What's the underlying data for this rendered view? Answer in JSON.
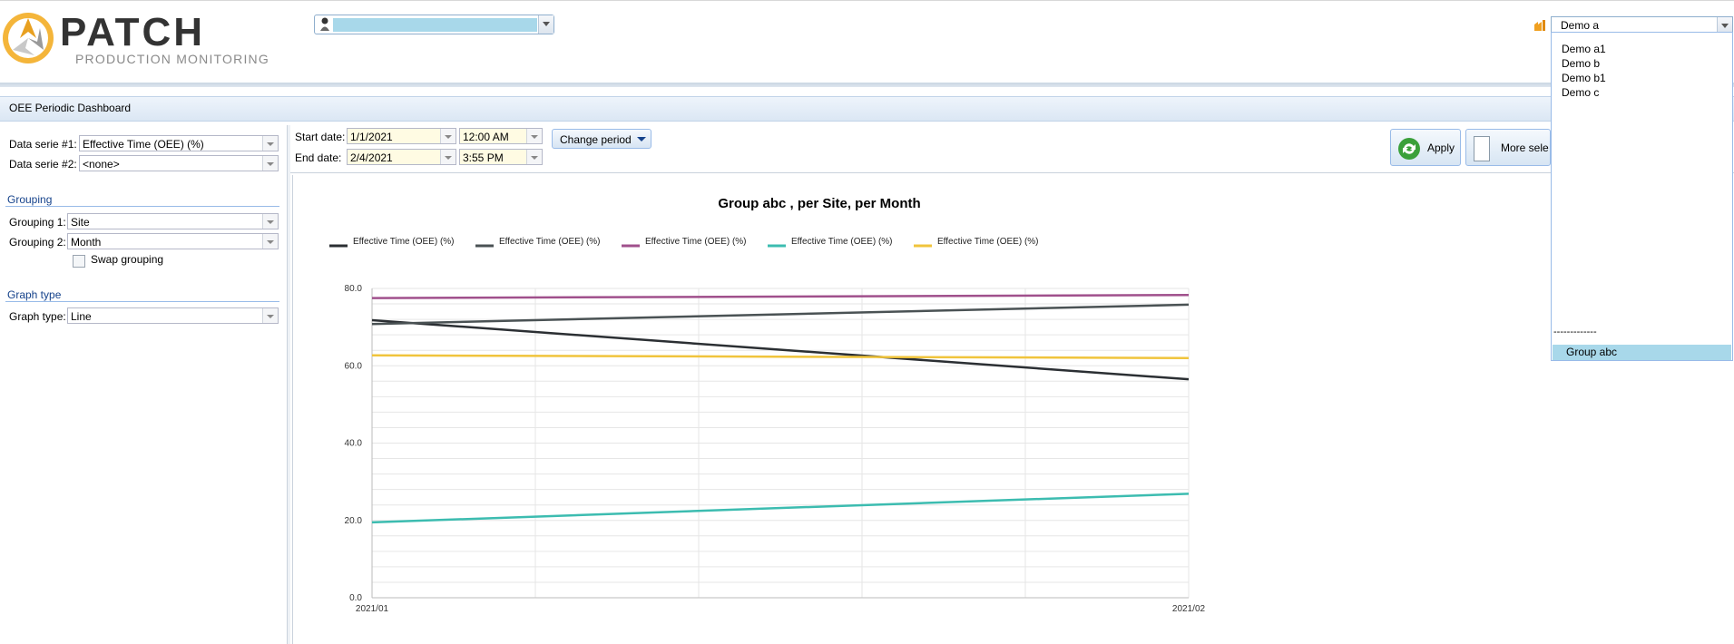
{
  "header": {
    "logo_title": "PATCH",
    "logo_subtitle": "PRODUCTION MONITORING",
    "user_selector_value": "",
    "site_selector_value": "Demo a"
  },
  "dashboard": {
    "title": "OEE Periodic Dashboard"
  },
  "left_panel": {
    "data_serie_1_label": "Data serie #1:",
    "data_serie_1_value": "Effective Time (OEE) (%)",
    "data_serie_2_label": "Data serie #2:",
    "data_serie_2_value": "<none>",
    "grouping_section": "Grouping",
    "grouping_1_label": "Grouping 1:",
    "grouping_1_value": "Site",
    "grouping_2_label": "Grouping 2:",
    "grouping_2_value": "Month",
    "swap_grouping_label": "Swap grouping",
    "graph_type_section": "Graph type",
    "graph_type_label": "Graph type:",
    "graph_type_value": "Line"
  },
  "period": {
    "start_label": "Start date:",
    "start_date": "1/1/2021",
    "start_time": "12:00 AM",
    "end_label": "End date:",
    "end_date": "2/4/2021",
    "end_time": "3:55 PM",
    "change_period_label": "Change period",
    "apply_label": "Apply",
    "more_label": "More sele"
  },
  "dropdown": {
    "items": [
      "Demo a1",
      "Demo b",
      "Demo b1",
      "Demo c"
    ],
    "separator": "-------------",
    "selected_item": "Group abc"
  },
  "colors": {
    "accent": "#99bbe8",
    "series": [
      "#2b2f33",
      "#4a5254",
      "#a0508c",
      "#3cbcb0",
      "#f0c43c"
    ]
  },
  "chart_data": {
    "type": "line",
    "title": "Group abc  , per Site, per Month",
    "xlabel": "",
    "ylabel": "",
    "categories": [
      "2021/01",
      "2021/02"
    ],
    "ylim": [
      0,
      80
    ],
    "yticks": [
      "0.0",
      "20.0",
      "40.0",
      "60.0",
      "80.0"
    ],
    "grid": true,
    "legend_position": "top",
    "series": [
      {
        "name": "Effective Time (OEE) (%)",
        "color": "#2b2f33",
        "values": [
          71.8,
          56.5
        ]
      },
      {
        "name": "Effective Time (OEE) (%)",
        "color": "#4a5254",
        "values": [
          70.8,
          75.8
        ]
      },
      {
        "name": "Effective Time (OEE) (%)",
        "color": "#a0508c",
        "values": [
          77.5,
          78.3
        ]
      },
      {
        "name": "Effective Time (OEE) (%)",
        "color": "#3cbcb0",
        "values": [
          19.5,
          26.9
        ]
      },
      {
        "name": "Effective Time (OEE) (%)",
        "color": "#f0c43c",
        "values": [
          62.7,
          62.0
        ]
      }
    ]
  }
}
